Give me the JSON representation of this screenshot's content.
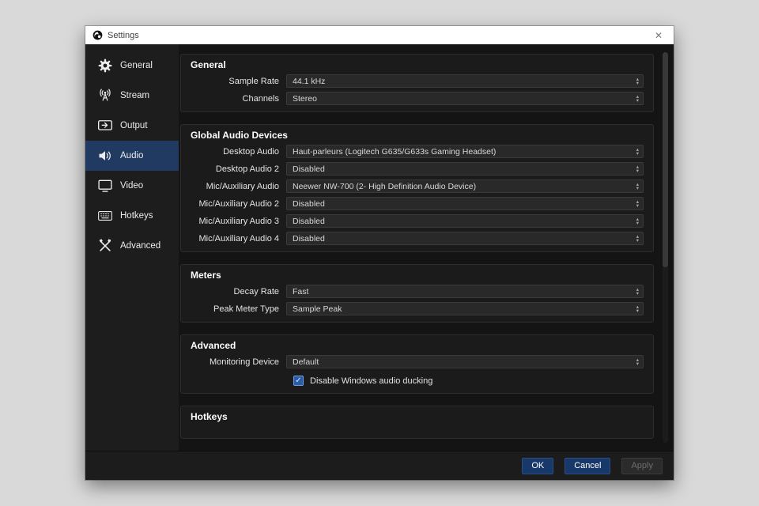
{
  "window": {
    "title": "Settings",
    "close_glyph": "✕"
  },
  "sidebar": {
    "items": [
      {
        "label": "General"
      },
      {
        "label": "Stream"
      },
      {
        "label": "Output"
      },
      {
        "label": "Audio"
      },
      {
        "label": "Video"
      },
      {
        "label": "Hotkeys"
      },
      {
        "label": "Advanced"
      }
    ],
    "selected": "Audio"
  },
  "content": {
    "sections": [
      {
        "title": "General",
        "rows": [
          {
            "label": "Sample Rate",
            "value": "44.1 kHz"
          },
          {
            "label": "Channels",
            "value": "Stereo"
          }
        ]
      },
      {
        "title": "Global Audio Devices",
        "rows": [
          {
            "label": "Desktop Audio",
            "value": "Haut-parleurs (Logitech G635/G633s Gaming Headset)"
          },
          {
            "label": "Desktop Audio 2",
            "value": "Disabled"
          },
          {
            "label": "Mic/Auxiliary Audio",
            "value": "Neewer NW-700 (2- High Definition Audio Device)"
          },
          {
            "label": "Mic/Auxiliary Audio 2",
            "value": "Disabled"
          },
          {
            "label": "Mic/Auxiliary Audio 3",
            "value": "Disabled"
          },
          {
            "label": "Mic/Auxiliary Audio 4",
            "value": "Disabled"
          }
        ]
      },
      {
        "title": "Meters",
        "rows": [
          {
            "label": "Decay Rate",
            "value": "Fast"
          },
          {
            "label": "Peak Meter Type",
            "value": "Sample Peak"
          }
        ]
      },
      {
        "title": "Advanced",
        "rows": [
          {
            "label": "Monitoring Device",
            "value": "Default"
          }
        ],
        "checkbox": {
          "label": "Disable Windows audio ducking",
          "checked": true
        }
      },
      {
        "title": "Hotkeys",
        "rows": []
      }
    ]
  },
  "footer": {
    "ok": "OK",
    "cancel": "Cancel",
    "apply": "Apply"
  },
  "colors": {
    "sidebar_selected": "#213a61",
    "button_primary": "#19386a",
    "checkbox_fill": "#2b5ca8",
    "titlebar_bg": "#ffffff",
    "panel_bg": "#1b1b1b"
  }
}
